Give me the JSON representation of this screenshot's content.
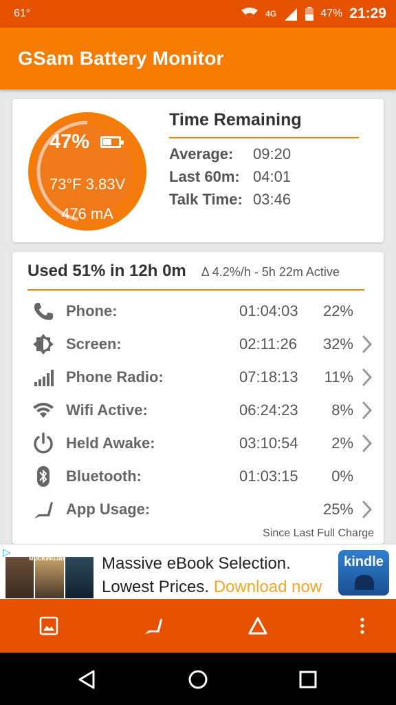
{
  "status_bar": {
    "temperature": "61°",
    "network": "4G",
    "battery": "47%",
    "time": "21:29"
  },
  "app": {
    "title": "GSam Battery Monitor"
  },
  "battery_summary": {
    "percent": "47%",
    "temp_voltage": "73°F  3.83V",
    "current": "476 mA",
    "level": 0.47
  },
  "time_remaining": {
    "title": "Time Remaining",
    "rows": [
      {
        "label": "Average:",
        "value": "09:20"
      },
      {
        "label": "Last 60m:",
        "value": "04:01"
      },
      {
        "label": "Talk Time:",
        "value": "03:46"
      }
    ]
  },
  "usage": {
    "headline": "Used 51% in 12h 0m",
    "rate": "Δ 4.2%/h - 5h 22m Active",
    "since": "Since Last Full Charge",
    "rows": [
      {
        "icon": "phone-icon",
        "name": "Phone:",
        "time": "01:04:03",
        "pct": "22%",
        "chevron": false
      },
      {
        "icon": "screen-brightness-icon",
        "name": "Screen:",
        "time": "02:11:26",
        "pct": "32%",
        "chevron": true
      },
      {
        "icon": "signal-bars-icon",
        "name": "Phone Radio:",
        "time": "07:18:13",
        "pct": "11%",
        "chevron": true
      },
      {
        "icon": "wifi-icon",
        "name": "Wifi Active:",
        "time": "06:24:23",
        "pct": "8%",
        "chevron": true
      },
      {
        "icon": "power-icon",
        "name": "Held Awake:",
        "time": "03:10:54",
        "pct": "2%",
        "chevron": true
      },
      {
        "icon": "bluetooth-icon",
        "name": "Bluetooth:",
        "time": "01:03:15",
        "pct": "0%",
        "chevron": false
      },
      {
        "icon": "app-usage-icon",
        "name": "App Usage:",
        "time": "",
        "pct": "25%",
        "chevron": true
      }
    ]
  },
  "ad": {
    "book_label": "MOCKINGJAY",
    "line1": "Massive eBook Selection.",
    "line2_prefix": "Lowest Prices. ",
    "line2_link": "Download now",
    "brand": "kindle"
  },
  "colors": {
    "primary": "#f57c00",
    "primary_dark": "#e65100",
    "circle_fill": "#f07a1a"
  }
}
